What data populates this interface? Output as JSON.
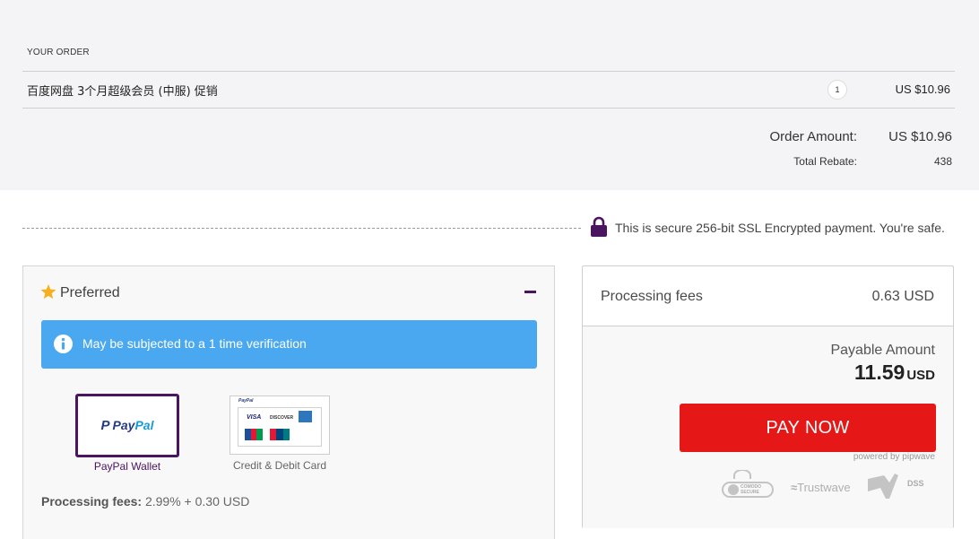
{
  "order": {
    "heading": "YOUR ORDER",
    "item": {
      "name": "百度网盘 3个月超级会员 (中服) 促销",
      "quantity": "1",
      "price": "US $10.96"
    },
    "order_amount_label": "Order Amount:",
    "order_amount_value": "US $10.96",
    "total_rebate_label": "Total Rebate:",
    "total_rebate_value": "438"
  },
  "security": {
    "message": "This is secure 256-bit SSL Encrypted payment. You're safe.",
    "icon": "lock-icon"
  },
  "preferred": {
    "title": "Preferred",
    "alert": "May be subjected to a 1 time verification",
    "methods": [
      {
        "name": "paypal-wallet",
        "label": "PayPal Wallet",
        "logo_text_pay": "Pay",
        "logo_text_pal": "Pal",
        "logo_mark": "P",
        "selected": true
      },
      {
        "name": "credit-debit-card",
        "label": "Credit & Debit Card",
        "selected": false,
        "logos": {
          "paypal": "PayPal",
          "visa": "VISA",
          "discover": "DISCOVER"
        }
      }
    ],
    "fees_label": "Processing fees:",
    "fees_value": "2.99% + 0.30 USD"
  },
  "summary": {
    "processing_fees_label": "Processing fees",
    "processing_fees_value": "0.63 USD",
    "payable_label": "Payable Amount",
    "payable_value": "11.59",
    "payable_currency": "USD",
    "pay_button": "PAY NOW",
    "powered_by": "powered by pipwave",
    "trust_badges": [
      {
        "name": "comodo-secure-badge",
        "text": "COMODO SECURE"
      },
      {
        "name": "trustwave-badge",
        "text": "Trustwave"
      },
      {
        "name": "pci-dss-badge",
        "text": "DSS"
      }
    ]
  },
  "colors": {
    "brand_purple": "#4a1460",
    "alert_blue": "#49a8f0",
    "pay_red": "#e51717",
    "star_gold": "#f6b01e"
  }
}
